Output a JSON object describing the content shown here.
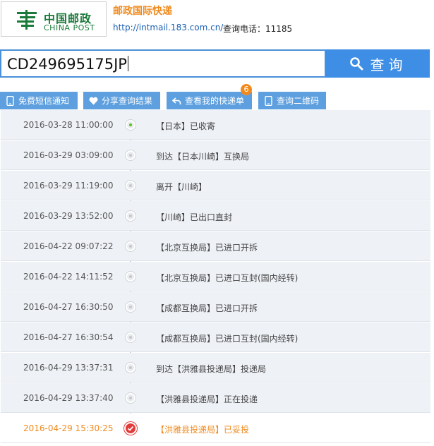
{
  "header": {
    "logo_cn": "中国邮政",
    "logo_en": "CHINA POST",
    "brand_title": "邮政国际快递",
    "url": "http://intmail.183.com.cn/",
    "phone": "查询电话：11185"
  },
  "search": {
    "value": "CD249695175JP",
    "button_label": "查询"
  },
  "toolbar": {
    "sms": "免费短信通知",
    "share": "分享查询结果",
    "my_list": "查看我的快递单",
    "my_list_badge": "6",
    "qrcode": "查询二维码"
  },
  "colors": {
    "accent_blue": "#3f8ee5",
    "accent_orange": "#f08a1c",
    "post_green": "#1a7a3a"
  },
  "tracking": [
    {
      "time": "2016-03-28 11:00:00",
      "status": "【日本】已收寄"
    },
    {
      "time": "2016-03-29 03:09:00",
      "status": "到达【日本川崎】互换局"
    },
    {
      "time": "2016-03-29 11:19:00",
      "status": "离开【川崎】"
    },
    {
      "time": "2016-03-29 13:52:00",
      "status": "【川崎】已出口直封"
    },
    {
      "time": "2016-04-22 09:07:22",
      "status": "【北京互换局】已进口开拆"
    },
    {
      "time": "2016-04-22 14:11:52",
      "status": "【北京互换局】已进口互封(国内经转)"
    },
    {
      "time": "2016-04-27 16:30:50",
      "status": "【成都互换局】已进口开拆"
    },
    {
      "time": "2016-04-27 16:30:54",
      "status": "【成都互换局】已进口互封(国内经转)"
    },
    {
      "time": "2016-04-29 13:37:31",
      "status": "到达【洪雅县投递局】投递局"
    },
    {
      "time": "2016-04-29 13:37:40",
      "status": "【洪雅县投递局】正在投递"
    },
    {
      "time": "2016-04-29 15:30:25",
      "status": "【洪雅县投递局】已妥投"
    }
  ]
}
